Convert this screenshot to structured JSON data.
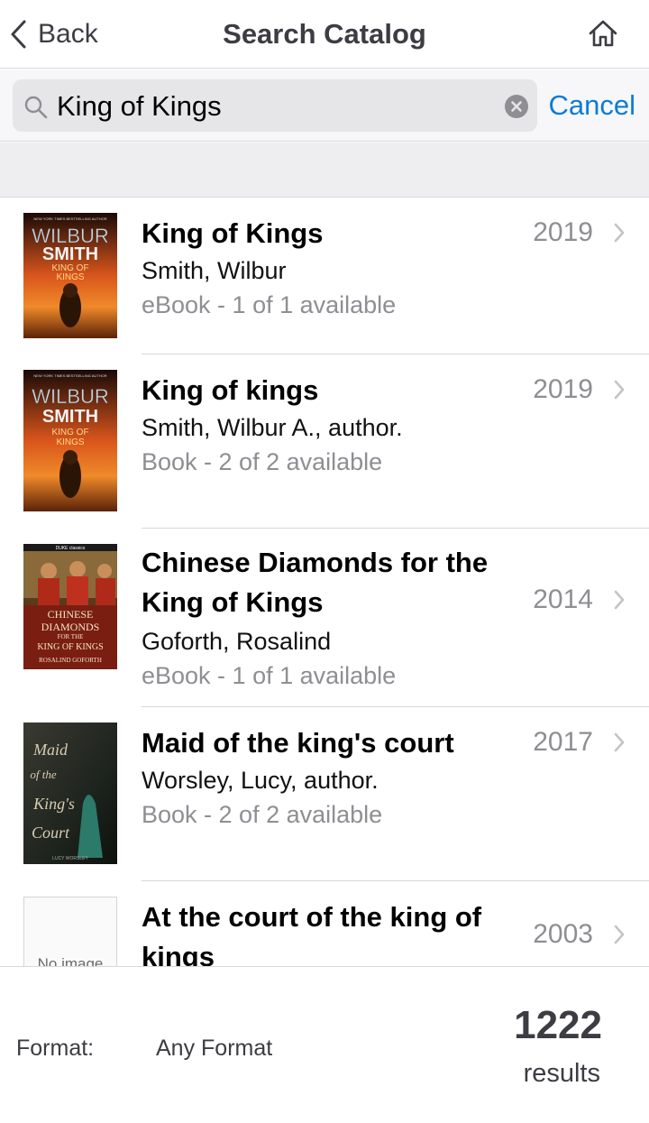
{
  "nav": {
    "back_label": "Back",
    "title": "Search Catalog"
  },
  "search": {
    "value": "King of Kings",
    "cancel_label": "Cancel"
  },
  "results": [
    {
      "title": "King of Kings",
      "author": "Smith, Wilbur",
      "availability": "eBook - 1 of 1 available",
      "year": "2019",
      "cover": {
        "top_text": "NEW YORK TIMES BESTSELLING AUTHOR",
        "name1": "WILBUR",
        "name2": "SMITH",
        "book1": "KING OF",
        "book2": "KINGS"
      }
    },
    {
      "title": "King of kings",
      "author": "Smith, Wilbur A., author.",
      "availability": "Book - 2 of 2 available",
      "year": "2019",
      "cover": {
        "top_text": "NEW YORK TIMES BESTSELLING AUTHOR",
        "name1": "WILBUR",
        "name2": "SMITH",
        "book1": "KING OF",
        "book2": "KINGS"
      }
    },
    {
      "title_line1": "Chinese Diamonds for the",
      "title_line2": "King of Kings",
      "author": "Goforth, Rosalind",
      "availability": "eBook - 1 of 1 available",
      "year": "2014",
      "cover": {
        "series": "DUKE classics",
        "t1": "CHINESE",
        "t2": "DIAMONDS",
        "t3": "FOR THE",
        "t4": "KING OF KINGS",
        "t5": "ROSALIND GOFORTH"
      }
    },
    {
      "title": "Maid of the king's court",
      "author": "Worsley, Lucy, author.",
      "availability": "Book - 2 of 2 available",
      "year": "2017",
      "cover": {
        "t1": "Maid",
        "t2": "of the",
        "t3": "King's",
        "t4": "Court",
        "t5": "LUCY WORSLEY"
      }
    },
    {
      "title_line1": "At the court of the king of",
      "title_line2": "kings",
      "year": "2003",
      "cover": {
        "placeholder": "No image"
      }
    }
  ],
  "footer": {
    "format_label": "Format:",
    "format_value": "Any Format",
    "count": "1222",
    "count_label": "results"
  },
  "colors": {
    "accent": "#0a7cd6",
    "secondary_text": "#8e8e93"
  }
}
